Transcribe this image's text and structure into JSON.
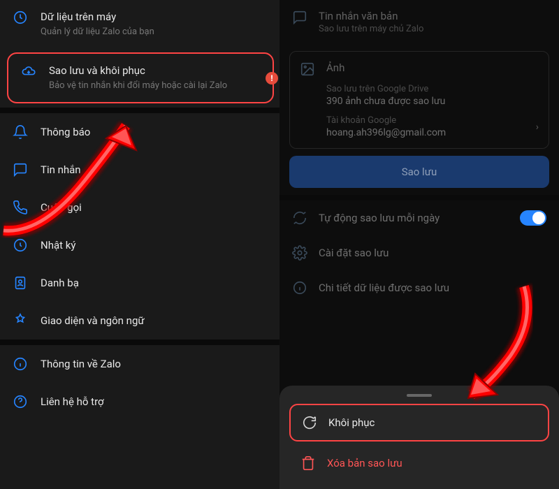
{
  "left": {
    "items": [
      {
        "title": "Dữ liệu trên máy",
        "subtitle": "Quản lý dữ liệu Zalo của bạn"
      },
      {
        "title": "Sao lưu và khôi phục",
        "subtitle": "Bảo vệ tin nhắn khi đổi máy hoặc cài lại Zalo"
      },
      {
        "title": "Thông báo"
      },
      {
        "title": "Tin nhắn"
      },
      {
        "title": "Cuộc gọi"
      },
      {
        "title": "Nhật ký"
      },
      {
        "title": "Danh bạ"
      },
      {
        "title": "Giao diện và ngôn ngữ"
      },
      {
        "title": "Thông tin về Zalo"
      },
      {
        "title": "Liên hệ hỗ trợ"
      }
    ],
    "alert": "!"
  },
  "right": {
    "text_msg": {
      "title": "Tin nhắn văn bản",
      "subtitle": "Sao lưu trên máy chủ Zalo"
    },
    "photo": {
      "header": "Ảnh",
      "storage_label": "Sao lưu trên Google Drive",
      "storage_value": "390 ảnh chưa được sao lưu",
      "account_label": "Tài khoản Google",
      "account_value": "hoang.ah396lg@gmail.com"
    },
    "backup_btn": "Sao lưu",
    "auto_backup": "Tự động sao lưu mỗi ngày",
    "settings_row": "Cài đặt sao lưu",
    "details_row": "Chi tiết dữ liệu được sao lưu",
    "restore": "Khôi phục",
    "delete": "Xóa bản sao lưu"
  }
}
